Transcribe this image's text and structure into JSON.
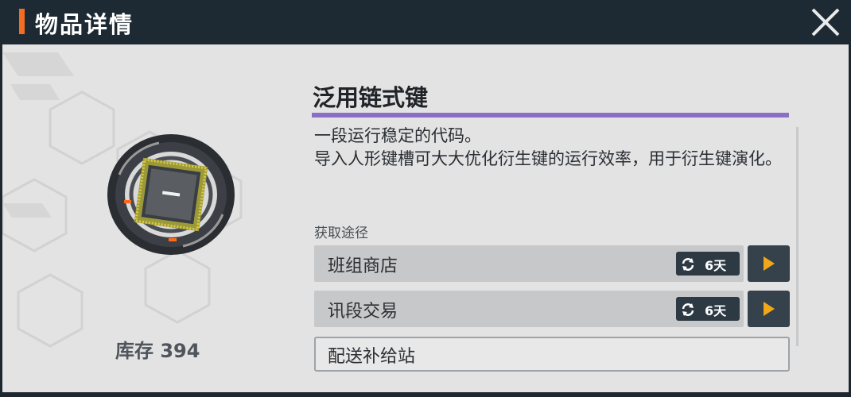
{
  "header": {
    "title": "物品详情"
  },
  "item": {
    "name": "泛用链式键",
    "description": "一段运行稳定的代码。\n导入人形键槽可大大优化衍生键的运行效率，用于衍生键演化。",
    "stock_label": "库存 394",
    "rarity_color": "#8b6fc6"
  },
  "acquisition": {
    "section_label": "获取途径",
    "sources": [
      {
        "label": "班组商店",
        "timer": "6天",
        "icon": "refresh-icon"
      },
      {
        "label": "讯段交易",
        "timer": "6天",
        "icon": "refresh-icon"
      },
      {
        "label": "配送补给站"
      }
    ]
  },
  "colors": {
    "accent": "#f26c22",
    "go_arrow": "#f0a818",
    "header_bg": "#1e2a33"
  }
}
